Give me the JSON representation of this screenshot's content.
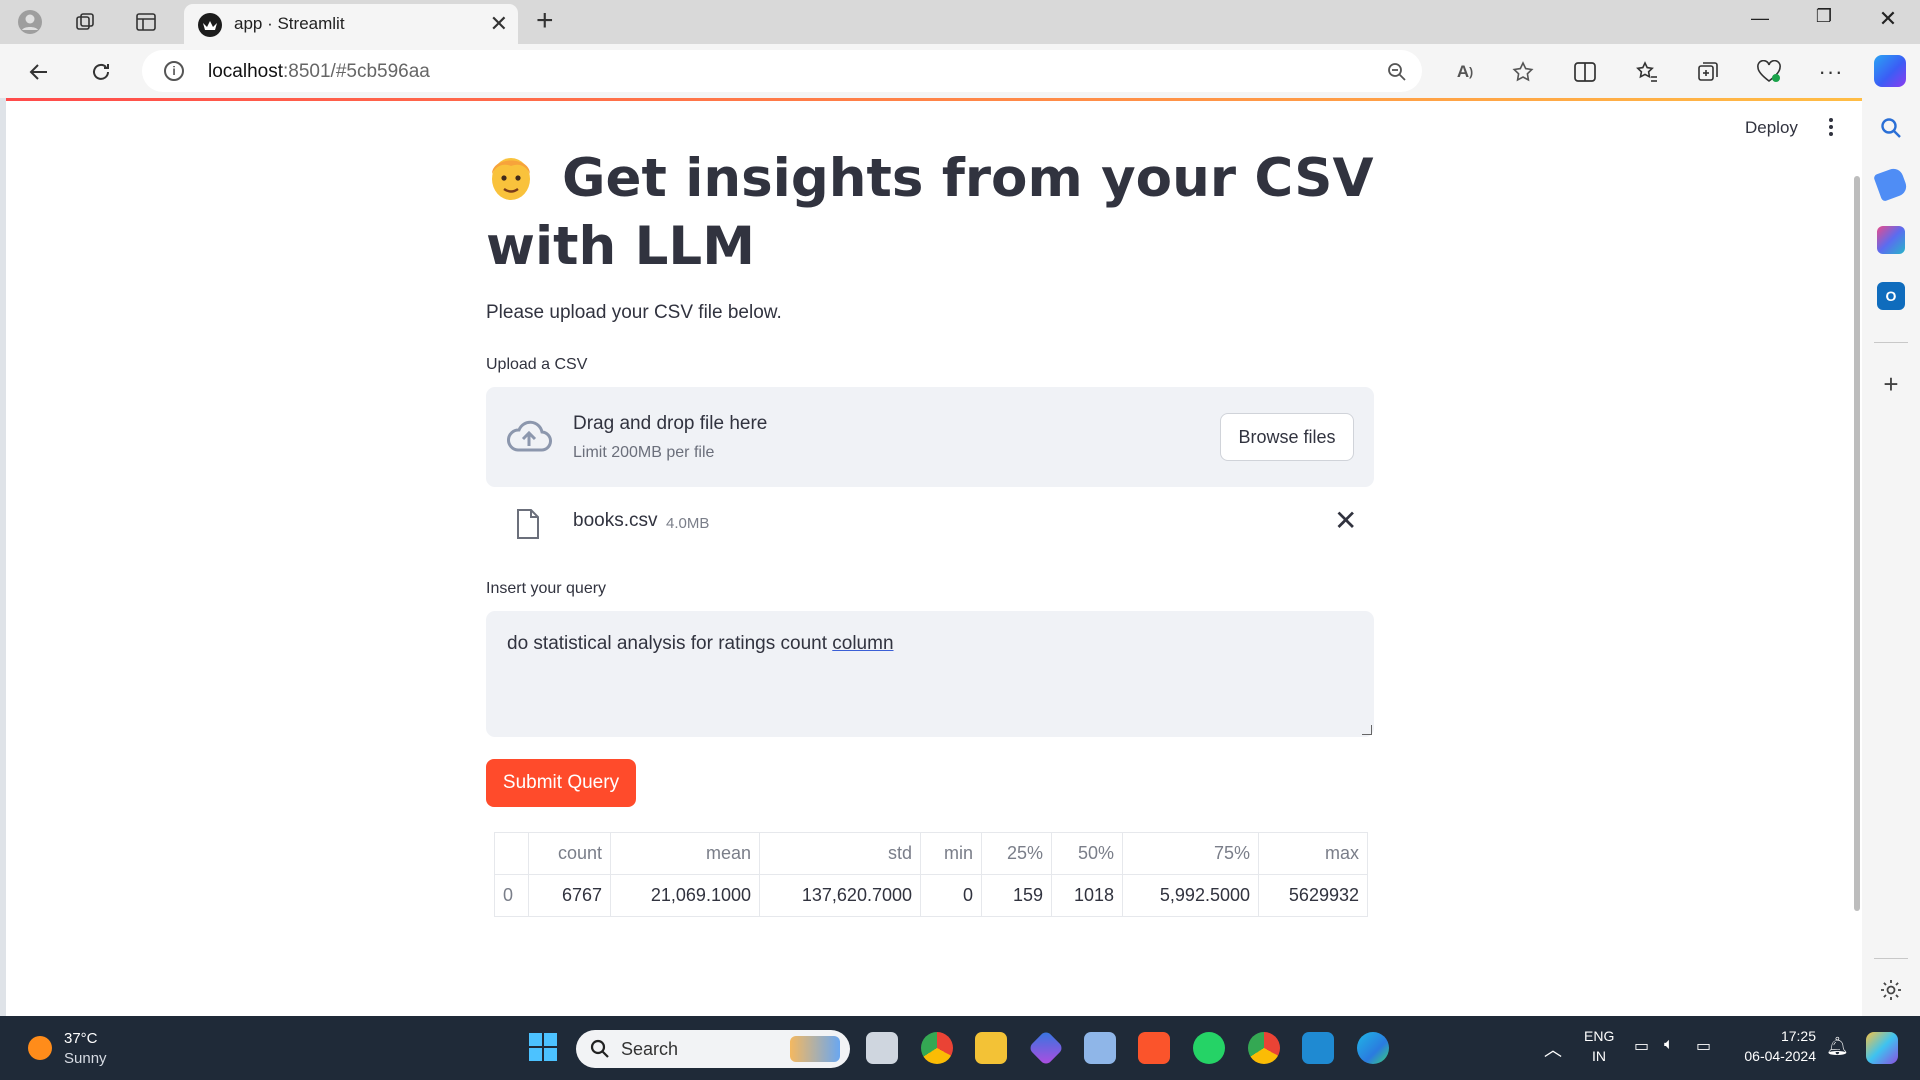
{
  "browser": {
    "tab_title": "app · Streamlit",
    "url_host": "localhost",
    "url_rest": ":8501/#5cb596aa"
  },
  "app": {
    "deploy_label": "Deploy",
    "title": "Get insights from your CSV with LLM",
    "subtitle": "Please upload your CSV file below.",
    "upload_label": "Upload a CSV",
    "dropzone_title": "Drag and drop file here",
    "dropzone_limit": "Limit 200MB per file",
    "browse_label": "Browse files",
    "file_name": "books.csv",
    "file_size": "4.0MB",
    "query_label": "Insert your query",
    "query_value_start": "do statistical analysis for ratings count ",
    "query_value_last": "column",
    "submit_label": "Submit Query",
    "table": {
      "headers": [
        "",
        "count",
        "mean",
        "std",
        "min",
        "25%",
        "50%",
        "75%",
        "max"
      ],
      "rows": [
        [
          "0",
          "6767",
          "21,069.1000",
          "137,620.7000",
          "0",
          "159",
          "1018",
          "5,992.5000",
          "5629932"
        ]
      ]
    }
  },
  "taskbar": {
    "temperature": "37°C",
    "weather": "Sunny",
    "search_placeholder": "Search",
    "lang_1": "ENG",
    "lang_2": "IN",
    "time": "17:25",
    "date": "06-04-2024"
  },
  "colors": {
    "accent": "#ff4b2b",
    "text": "#31333f",
    "panel": "#f0f2f6"
  }
}
